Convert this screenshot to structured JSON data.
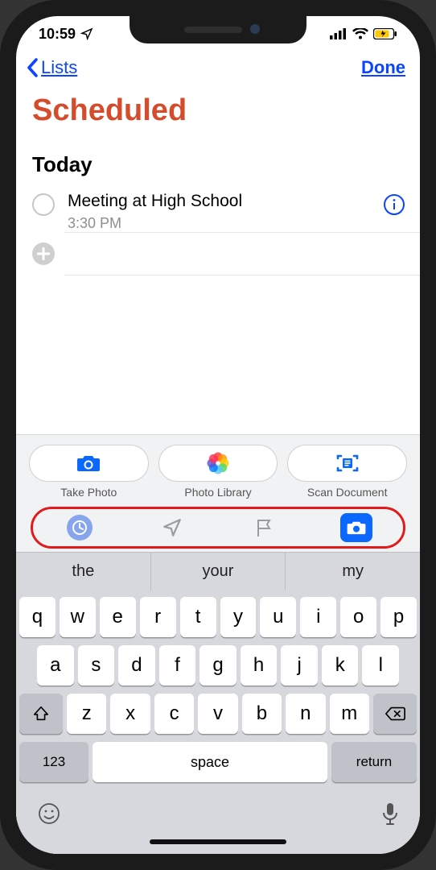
{
  "status": {
    "time": "10:59"
  },
  "nav": {
    "back_label": "Lists",
    "done_label": "Done"
  },
  "title": "Scheduled",
  "section_header": "Today",
  "reminder": {
    "title": "Meeting at High School",
    "time": "3:30 PM"
  },
  "attachments": {
    "take_photo_label": "Take Photo",
    "photo_library_label": "Photo Library",
    "scan_document_label": "Scan Document"
  },
  "toolbar_icons": [
    "clock-icon",
    "location-icon",
    "flag-icon",
    "camera-icon"
  ],
  "suggestions": [
    "the",
    "your",
    "my"
  ],
  "keyboard": {
    "row1": [
      "q",
      "w",
      "e",
      "r",
      "t",
      "y",
      "u",
      "i",
      "o",
      "p"
    ],
    "row2": [
      "a",
      "s",
      "d",
      "f",
      "g",
      "h",
      "j",
      "k",
      "l"
    ],
    "row3": [
      "z",
      "x",
      "c",
      "v",
      "b",
      "n",
      "m"
    ],
    "num_key": "123",
    "space_label": "space",
    "return_label": "return"
  },
  "colors": {
    "accent_blue": "#0b45ff",
    "title_color": "#d54c2c",
    "highlight_red": "#e11b1b"
  }
}
